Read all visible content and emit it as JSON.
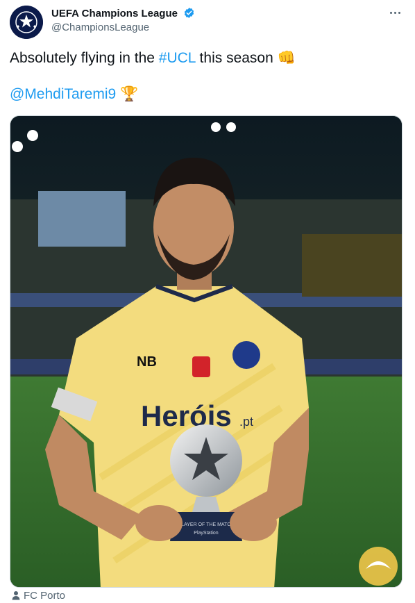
{
  "account": {
    "display_name": "UEFA Champions League",
    "handle": "@ChampionsLeague",
    "verified_icon": "verified-badge-icon",
    "avatar_icon": "ucl-starball-logo"
  },
  "tweet": {
    "text_prefix": "Absolutely flying in the ",
    "hashtag": "#UCL",
    "text_suffix": " this season ",
    "emoji_fist": "👊",
    "mention": "@MehdiTaremi9",
    "emoji_trophy": "🏆"
  },
  "media": {
    "shirt_brand": "NB",
    "sponsor": "Heróis",
    "sponsor_suffix": ".pt",
    "trophy_caption": "PLAYER OF THE MATCH",
    "trophy_brand": "PlayStation"
  },
  "tagged": {
    "icon": "person-icon",
    "label": "FC Porto"
  },
  "colors": {
    "link": "#1d9bf0",
    "verified": "#1d9bf0",
    "text": "#0f1419",
    "secondary": "#536471",
    "jersey": "#f3dc7e",
    "pitch": "#2f6b2c"
  }
}
